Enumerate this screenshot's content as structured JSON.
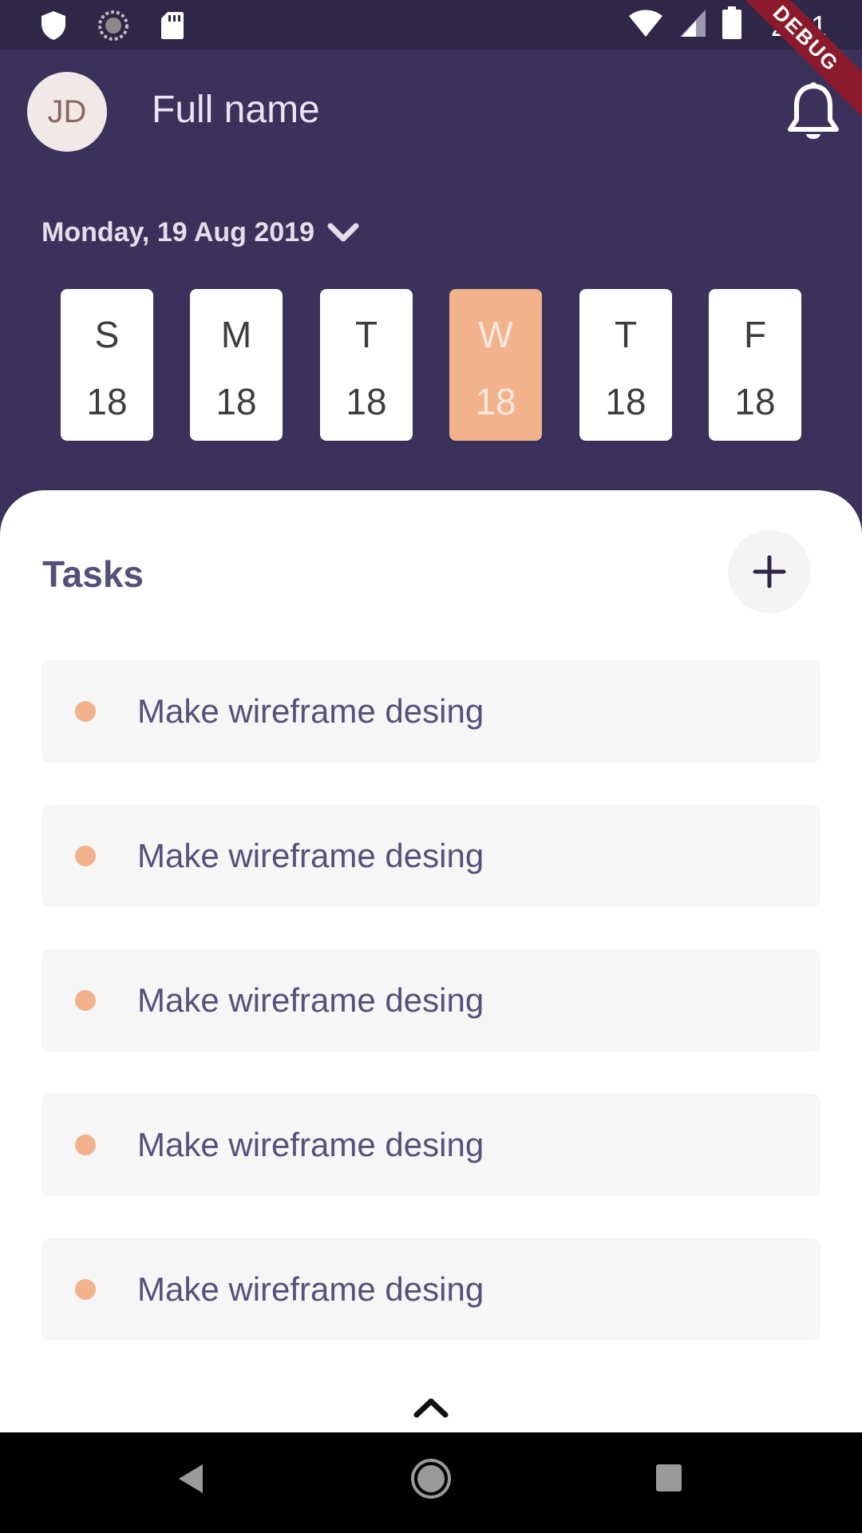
{
  "status_bar": {
    "time": "2:31",
    "debug_label": "DEBUG",
    "left_icons": [
      "shield-icon",
      "sync-icon",
      "sd-card-icon"
    ],
    "right_icons": [
      "wifi-icon",
      "cell-signal-icon",
      "battery-icon"
    ]
  },
  "header": {
    "avatar_initials": "JD",
    "full_name": "Full name",
    "notification_icon": "bell-icon"
  },
  "date": {
    "label": "Monday, 19 Aug 2019",
    "dropdown_icon": "chevron-down-icon"
  },
  "days": [
    {
      "letter": "S",
      "number": "18",
      "selected": false
    },
    {
      "letter": "M",
      "number": "18",
      "selected": false
    },
    {
      "letter": "T",
      "number": "18",
      "selected": false
    },
    {
      "letter": "W",
      "number": "18",
      "selected": true
    },
    {
      "letter": "T",
      "number": "18",
      "selected": false
    },
    {
      "letter": "F",
      "number": "18",
      "selected": false
    }
  ],
  "tasks": {
    "title": "Tasks",
    "add_icon": "plus-icon",
    "items": [
      {
        "label": "Make wireframe desing"
      },
      {
        "label": "Make wireframe desing"
      },
      {
        "label": "Make wireframe desing"
      },
      {
        "label": "Make wireframe desing"
      },
      {
        "label": "Make wireframe desing"
      }
    ],
    "expand_icon": "chevron-up-icon"
  },
  "colors": {
    "header_bg": "#3b325c",
    "accent": "#f2b28c",
    "text_purple": "#57507a"
  },
  "nav": {
    "back_icon": "back-triangle-icon",
    "home_icon": "home-circle-icon",
    "recents_icon": "recents-square-icon"
  }
}
